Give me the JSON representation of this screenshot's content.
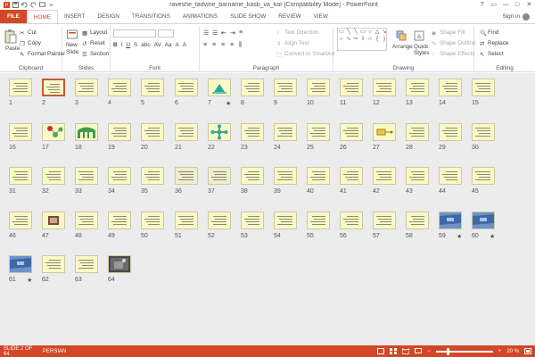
{
  "app": {
    "title": "raveshe_tadvine_barname_kasb_va_kar [Compatibility Mode] - PowerPoint",
    "window_controls": [
      "?",
      "▭",
      "—",
      "□",
      "✕"
    ]
  },
  "tabs": [
    {
      "label": "FILE",
      "kind": "file"
    },
    {
      "label": "HOME",
      "kind": "active"
    },
    {
      "label": "INSERT",
      "kind": ""
    },
    {
      "label": "DESIGN",
      "kind": ""
    },
    {
      "label": "TRANSITIONS",
      "kind": ""
    },
    {
      "label": "ANIMATIONS",
      "kind": ""
    },
    {
      "label": "SLIDE SHOW",
      "kind": ""
    },
    {
      "label": "REVIEW",
      "kind": ""
    },
    {
      "label": "VIEW",
      "kind": ""
    }
  ],
  "signin": "Sign in",
  "ribbon": {
    "clipboard": {
      "label": "Clipboard",
      "paste": "Paste",
      "cut": "Cut",
      "copy": "Copy",
      "format_painter": "Format Painter"
    },
    "slides": {
      "label": "Slides",
      "new_slide": "New",
      "new_slide2": "Slide",
      "layout": "Layout",
      "reset": "Reset",
      "section": "Section"
    },
    "font": {
      "label": "Font",
      "buttons": [
        "B",
        "I",
        "U",
        "S",
        "abc",
        "AV",
        "Aa",
        "A",
        "A"
      ]
    },
    "paragraph": {
      "label": "Paragraph",
      "text_direction": "Text Direction",
      "align_text": "Align Text",
      "convert_smartart": "Convert to SmartArt"
    },
    "drawing": {
      "label": "Drawing",
      "arrange": "Arrange",
      "quick_styles": "Quick",
      "quick_styles2": "Styles",
      "shape_fill": "Shape Fill",
      "shape_outline": "Shape Outline",
      "shape_effects": "Shape Effects"
    },
    "editing": {
      "label": "Editing",
      "find": "Find",
      "replace": "Replace",
      "select": "Select"
    }
  },
  "slides": {
    "selected": 2,
    "total": 64,
    "starred": [
      7,
      59,
      60,
      61
    ],
    "special": {
      "7": "teal",
      "17": "molecule",
      "18": "arch",
      "22": "cross",
      "27": "yellow",
      "36": "dark",
      "37": "dark",
      "47": "grid",
      "59": "blue",
      "60": "blue",
      "61": "blue",
      "64": "photo"
    }
  },
  "status": {
    "slide_indicator": "SLIDE 2 OF 64",
    "language": "PERSIAN",
    "zoom": "20 %",
    "zoom_minus": "−",
    "zoom_plus": "+"
  },
  "colors": {
    "accent": "#d24726",
    "slide_bg": "#fbf8c8"
  }
}
